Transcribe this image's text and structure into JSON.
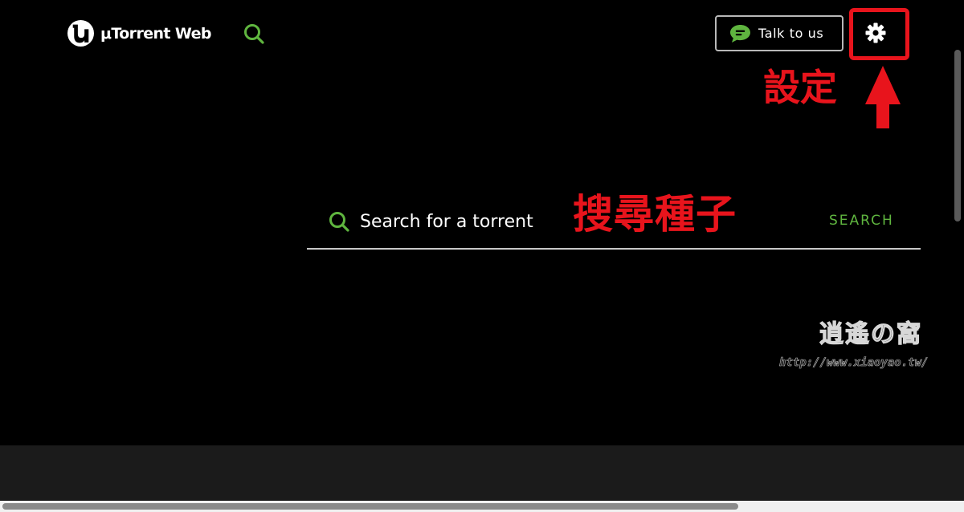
{
  "app": {
    "name": "μTorrent Web"
  },
  "header": {
    "talk_button_label": "Talk to us"
  },
  "annotations": {
    "settings_label": "設定",
    "search_label": "搜尋種子"
  },
  "search": {
    "placeholder": "Search for a torrent",
    "button_label": "SEARCH"
  },
  "watermark": {
    "title": "逍遙の窩",
    "url": "http://www.xiaoyao.tw/"
  },
  "colors": {
    "accent_green": "#5fb53f",
    "annotation_red": "#e8141c",
    "background": "#000000"
  },
  "icons": {
    "logo": "utorrent-logo-icon",
    "header_search": "search-icon",
    "chat": "chat-bubble-icon",
    "settings": "gear-icon"
  }
}
